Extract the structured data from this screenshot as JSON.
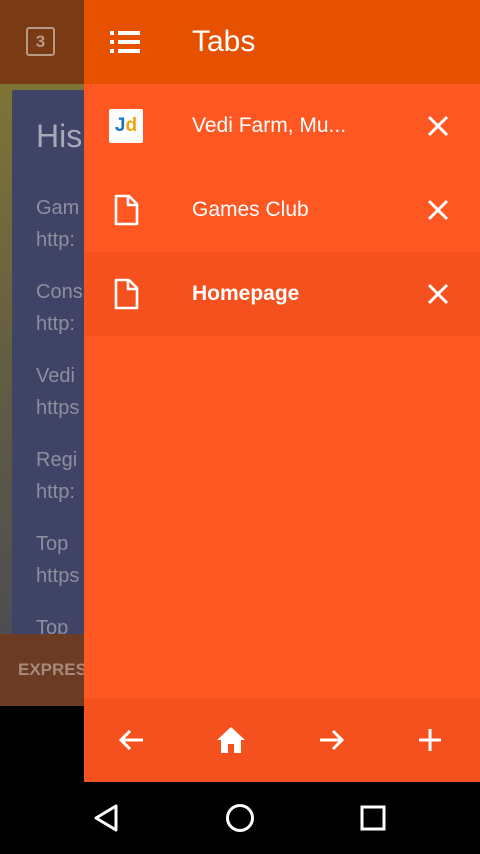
{
  "background": {
    "tab_count": "3",
    "history_title": "His",
    "items": [
      "Gam",
      "http:",
      "Cons",
      "http:",
      "Vedi",
      "https",
      "Regi",
      "http:",
      "Top",
      "https",
      "Top"
    ],
    "bottom_label": "EXPRES"
  },
  "drawer": {
    "title": "Tabs",
    "menu_icon": "list-icon",
    "tabs": [
      {
        "title": "Vedi Farm, Mu...",
        "icon": "jd-logo",
        "logo_text_j": "J",
        "logo_text_d": "d",
        "active": false
      },
      {
        "title": "Games Club",
        "icon": "page-icon",
        "active": false
      },
      {
        "title": "Homepage",
        "icon": "page-icon",
        "active": true
      }
    ],
    "close_icon": "close-icon",
    "bottom_nav": [
      "back-arrow-icon",
      "home-icon",
      "forward-arrow-icon",
      "plus-icon"
    ]
  },
  "system_nav": [
    "back-triangle-icon",
    "home-circle-icon",
    "recents-square-icon"
  ],
  "colors": {
    "drawer_bg": "#ff5722",
    "drawer_header": "#e65100",
    "active_row": "#f4511e"
  }
}
